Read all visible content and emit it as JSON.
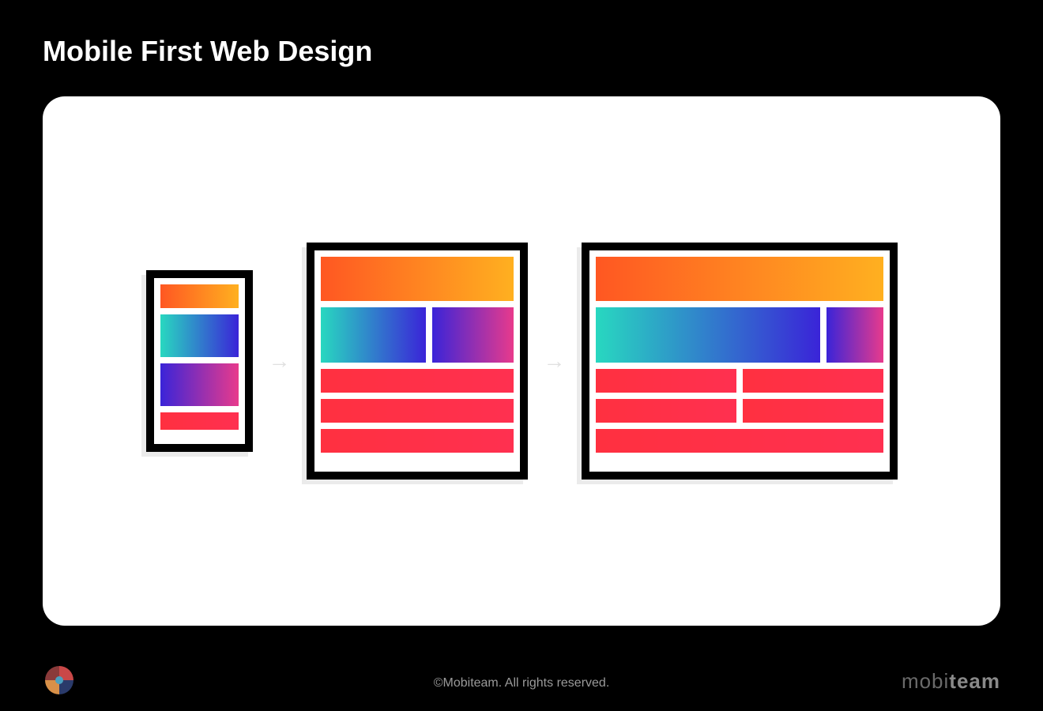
{
  "title": "Mobile First Web Design",
  "footer": {
    "copyright": "©Mobiteam. All rights reserved.",
    "brand_light": "mobi",
    "brand_bold": "team"
  },
  "arrows": {
    "glyph": "→"
  },
  "colors": {
    "orange_gradient": [
      "#ff5722",
      "#ffb020"
    ],
    "teal_blue_gradient": [
      "#28d8c0",
      "#3a24d8"
    ],
    "blue_pink_gradient": [
      "#3a24d8",
      "#e83a8c"
    ],
    "red": "#ff3040"
  },
  "devices": [
    {
      "type": "mobile",
      "label": "mobile-frame"
    },
    {
      "type": "tablet",
      "label": "tablet-frame"
    },
    {
      "type": "desktop",
      "label": "desktop-frame"
    }
  ]
}
